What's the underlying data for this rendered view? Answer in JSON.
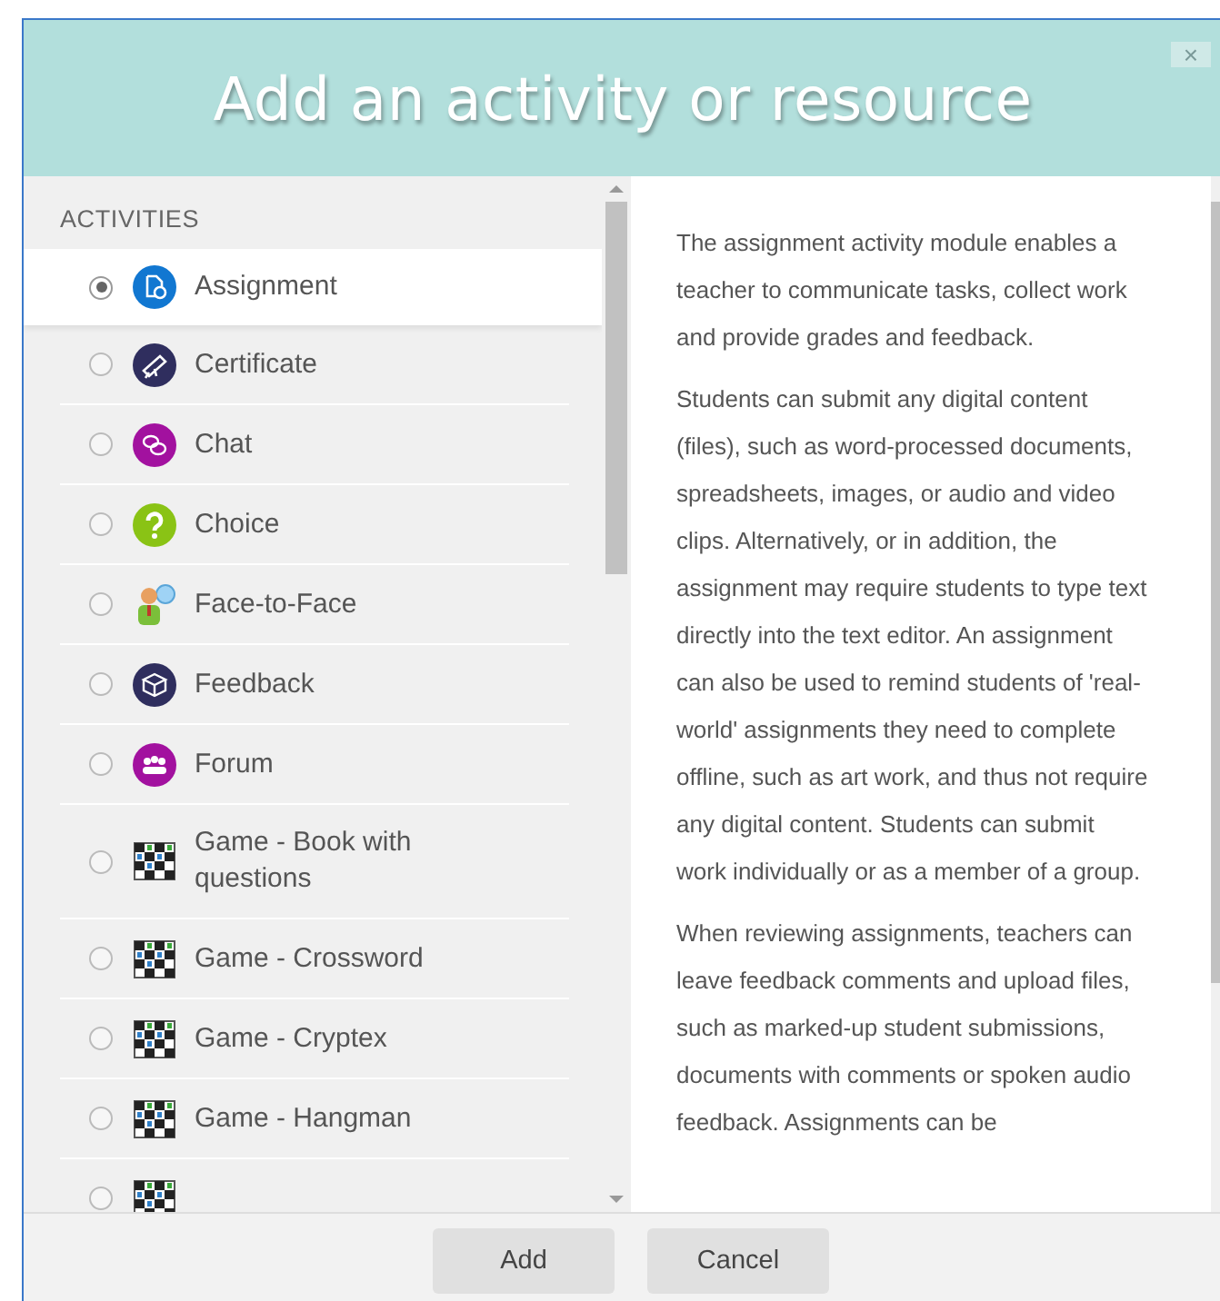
{
  "dialog": {
    "title": "Add an activity or resource",
    "close": "×"
  },
  "list": {
    "heading": "ACTIVITIES",
    "items": [
      {
        "kind": "assignment",
        "label": "Assignment",
        "selected": true
      },
      {
        "kind": "certificate",
        "label": "Certificate",
        "selected": false
      },
      {
        "kind": "chat",
        "label": "Chat",
        "selected": false
      },
      {
        "kind": "choice",
        "label": "Choice",
        "selected": false
      },
      {
        "kind": "facetoface",
        "label": "Face-to-Face",
        "selected": false
      },
      {
        "kind": "feedback",
        "label": "Feedback",
        "selected": false
      },
      {
        "kind": "forum",
        "label": "Forum",
        "selected": false
      },
      {
        "kind": "game",
        "label": "Game - Book with questions",
        "selected": false
      },
      {
        "kind": "game",
        "label": "Game - Crossword",
        "selected": false
      },
      {
        "kind": "game",
        "label": "Game - Cryptex",
        "selected": false
      },
      {
        "kind": "game",
        "label": "Game - Hangman",
        "selected": false
      },
      {
        "kind": "game",
        "selected": false
      }
    ]
  },
  "description": [
    "The assignment activity module enables a teacher to communicate tasks, collect work and provide grades and feedback.",
    "Students can submit any digital content (files), such as word-processed documents, spreadsheets, images, or audio and video clips. Alternatively, or in addition, the assignment may require students to type text directly into the text editor. An assignment can also be used to remind students of 'real-world' assignments they need to complete offline, such as art work, and thus not require any digital content. Students can submit work individually or as a member of a group.",
    "When reviewing assignments, teachers can leave feedback comments and upload files, such as marked-up student submissions, documents with comments or spoken audio feedback. Assignments can be"
  ],
  "buttons": [
    "Add",
    "Cancel"
  ]
}
